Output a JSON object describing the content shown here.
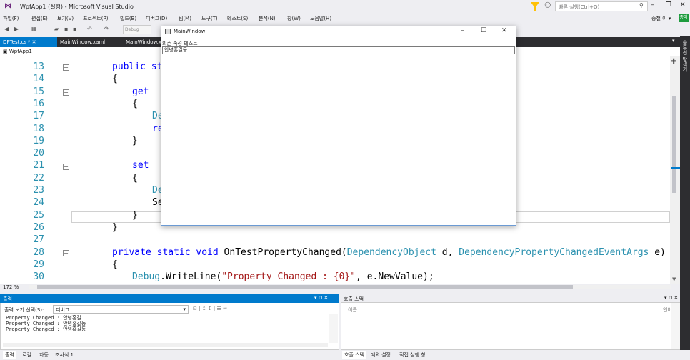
{
  "titlebar": {
    "title": "WpfApp1 (실행) - Microsoft Visual Studio",
    "quick_launch_placeholder": "빠른 실행(Ctrl+Q)"
  },
  "menu": {
    "items": [
      "파일(F)",
      "편집(E)",
      "보기(V)",
      "프로젝트(P)",
      "빌드(B)",
      "디버그(D)",
      "팀(M)",
      "도구(T)",
      "테스트(S)",
      "분석(N)",
      "창(W)",
      "도움말(H)"
    ],
    "account": "종철 이 ▾",
    "account_badge": "종이"
  },
  "toolbar": {
    "debug_combo": "Debug"
  },
  "tabs": {
    "active": "DPTest.cs",
    "second": "MainWindow.xaml",
    "third": "MainWindow.x"
  },
  "nav": {
    "project": "WpfApp1"
  },
  "right_strip": "솔루션 탐색기",
  "editor": {
    "zoom": "172 %",
    "lines": [
      {
        "n": "13",
        "segments": [
          [
            "kw",
            "public "
          ],
          [
            "kw",
            "str"
          ]
        ]
      },
      {
        "n": "14",
        "segments": [
          [
            "",
            "{"
          ]
        ]
      },
      {
        "n": "15",
        "segments": [
          [
            "kw",
            "get"
          ]
        ]
      },
      {
        "n": "16",
        "segments": [
          [
            "",
            "{"
          ]
        ]
      },
      {
        "n": "17",
        "segments": [
          [
            "ty",
            "De"
          ]
        ]
      },
      {
        "n": "18",
        "segments": [
          [
            "kw",
            "re"
          ]
        ]
      },
      {
        "n": "19",
        "segments": [
          [
            "",
            "}"
          ]
        ]
      },
      {
        "n": "20",
        "segments": []
      },
      {
        "n": "21",
        "segments": [
          [
            "kw",
            "set"
          ]
        ]
      },
      {
        "n": "22",
        "segments": [
          [
            "",
            "{"
          ]
        ]
      },
      {
        "n": "23",
        "segments": [
          [
            "ty",
            "De"
          ]
        ]
      },
      {
        "n": "24",
        "segments": [
          [
            "",
            "Se"
          ]
        ]
      },
      {
        "n": "25",
        "segments": [
          [
            "",
            "}"
          ]
        ]
      },
      {
        "n": "26",
        "segments": [
          [
            "",
            "}"
          ]
        ]
      },
      {
        "n": "27",
        "segments": []
      },
      {
        "n": "28",
        "segments": [
          [
            "kw",
            "private static void "
          ],
          [
            "",
            "OnTestPropertyChanged("
          ],
          [
            "ty",
            "DependencyObject"
          ],
          [
            "",
            " d, "
          ],
          [
            "ty",
            "DependencyPropertyChangedEventArgs"
          ],
          [
            "",
            " e)"
          ]
        ]
      },
      {
        "n": "29",
        "segments": [
          [
            "",
            "{"
          ]
        ]
      },
      {
        "n": "30",
        "segments": [
          [
            "ty",
            "Debug"
          ],
          [
            "",
            ".WriteLine("
          ],
          [
            "str",
            "\"Property Changed : {0}\""
          ],
          [
            "",
            ", e.NewValue);"
          ]
        ]
      }
    ]
  },
  "output": {
    "title": "출력",
    "header_controls": "▾ ⊓ ✕",
    "source_label": "출력 보기 선택(S):",
    "source_value": "디버그",
    "lines": [
      "Property Changed : 안녕홍길",
      "Property Changed : 안녕홍길동",
      "Property Changed : 안녕홍길동"
    ],
    "tabs": [
      "출력",
      "로컬",
      "자동",
      "조사식 1"
    ]
  },
  "callstack": {
    "title": "호출 스택",
    "header_controls": "▾ ⊓ ✕",
    "col_name": "이름",
    "col_lang": "언어",
    "tabs": [
      "호출 스택",
      "예외 설정",
      "직접 실행 창"
    ]
  },
  "wpf": {
    "title": "MainWindow",
    "label": "의존 속성 테스트",
    "textbox_value": "안녕홍길동"
  }
}
